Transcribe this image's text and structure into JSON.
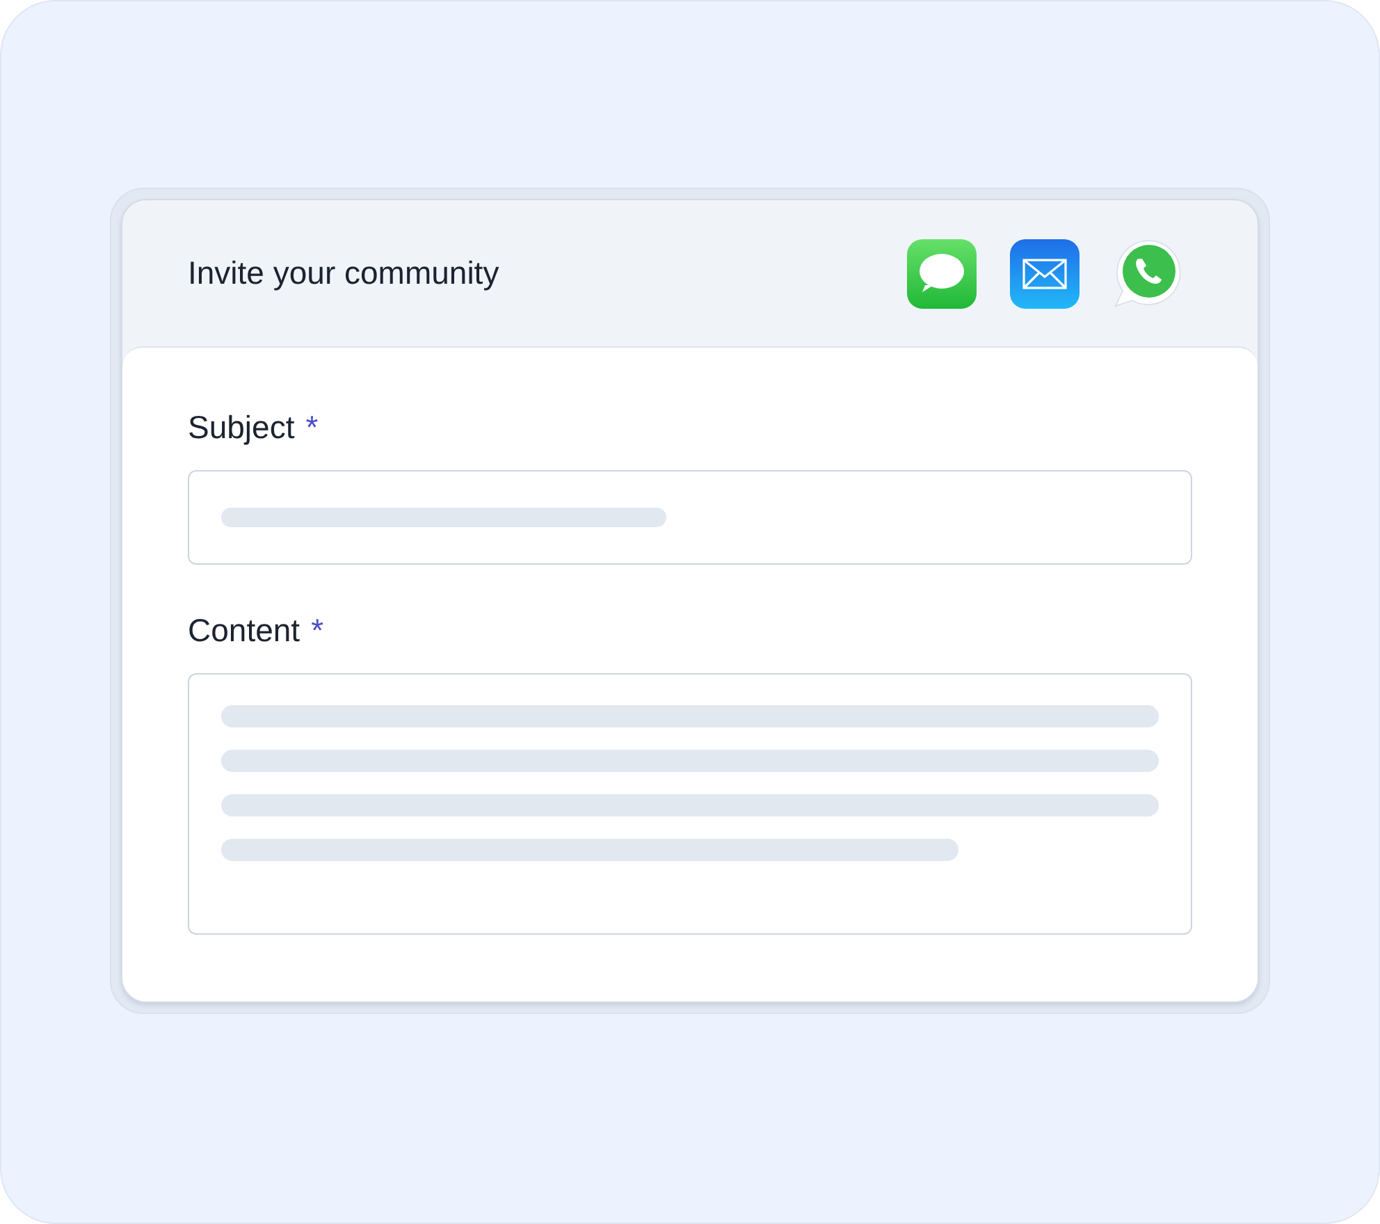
{
  "header": {
    "title": "Invite your community",
    "share_apps": [
      {
        "kind": "messages"
      },
      {
        "kind": "mail"
      },
      {
        "kind": "whatsapp"
      }
    ]
  },
  "fields": [
    {
      "kind": "input",
      "label": "Subject",
      "required_mark": "*"
    },
    {
      "kind": "textarea",
      "label": "Content",
      "required_mark": "*"
    }
  ]
}
